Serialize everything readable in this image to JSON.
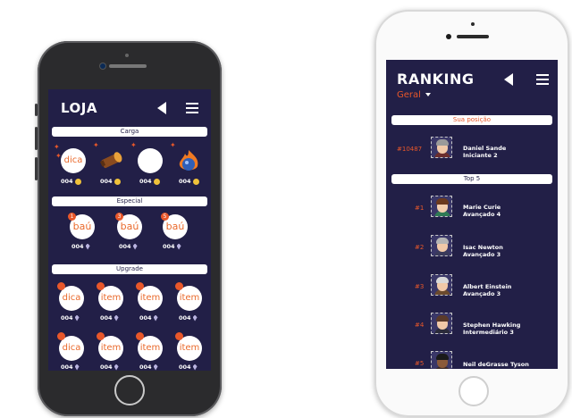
{
  "store": {
    "title": "LOJA",
    "sections": {
      "carga": "Carga",
      "especial": "Especial",
      "upgrade": "Upgrade"
    },
    "carga_items": [
      {
        "label": "dica",
        "price": "004"
      },
      {
        "label": "",
        "price": "004"
      },
      {
        "label": "",
        "price": "004"
      },
      {
        "label": "",
        "price": "004"
      }
    ],
    "especial_items": [
      {
        "label": "baú",
        "badge": "1",
        "price": "004"
      },
      {
        "label": "baú",
        "badge": "3",
        "price": "004"
      },
      {
        "label": "baú",
        "badge": "5",
        "price": "004"
      }
    ],
    "upgrade_row1": [
      {
        "label": "dica",
        "price": "004"
      },
      {
        "label": "item",
        "price": "004"
      },
      {
        "label": "item",
        "price": "004"
      },
      {
        "label": "item",
        "price": "004"
      }
    ],
    "upgrade_row2": [
      {
        "label": "dica",
        "price": "004"
      },
      {
        "label": "item",
        "price": "004"
      },
      {
        "label": "item",
        "price": "004"
      },
      {
        "label": "item",
        "price": "004"
      }
    ]
  },
  "ranking": {
    "title": "RANKING",
    "filter": "Geral",
    "my_position_label": "Sua posição",
    "top_label": "Top 5",
    "me": {
      "rank": "#10487",
      "name": "Daniel Sande",
      "level": "Iniciante 2"
    },
    "top5": [
      {
        "rank": "#1",
        "name": "Marie Curie",
        "level": "Avançado 4"
      },
      {
        "rank": "#2",
        "name": "Isac Newton",
        "level": "Avançado 3"
      },
      {
        "rank": "#3",
        "name": "Albert Einstein",
        "level": "Avançado 3"
      },
      {
        "rank": "#4",
        "name": "Stephen Hawking",
        "level": "Intermediário 3"
      },
      {
        "rank": "#5",
        "name": "Neil deGrasse Tyson",
        "level": ""
      }
    ]
  },
  "colors": {
    "screen_bg": "#221f47",
    "accent": "#e8572a",
    "coin": "#f0c23a"
  },
  "icons": [
    "back-arrow-icon",
    "menu-icon",
    "coin-icon",
    "gem-icon",
    "caret-down-icon"
  ]
}
